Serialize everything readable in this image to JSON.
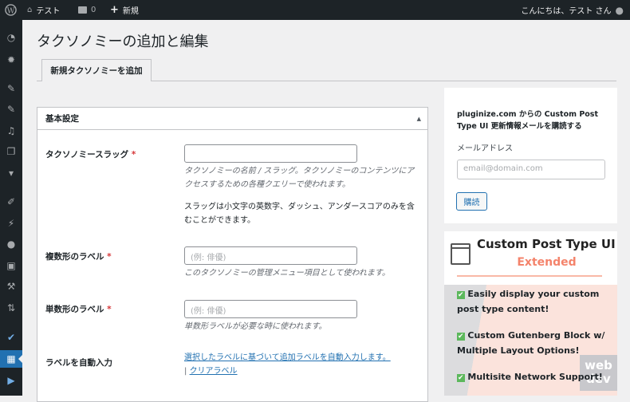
{
  "adminbar": {
    "site": "テスト",
    "comments": "0",
    "new": "新規",
    "greeting": "こんにちは、テスト さん"
  },
  "page": {
    "title": "タクソノミーの追加と編集",
    "tab": "新規タクソノミーを追加"
  },
  "box": {
    "title": "基本設定",
    "slug_label": "タクソノミースラッグ",
    "required": "*",
    "slug_desc": "タクソノミーの名前 / スラッグ。タクソノミーのコンテンツにアクセスするための各種クエリーで使われます。",
    "slug_note": "スラッグは小文字の英数字、ダッシュ、アンダースコアのみを含むことができます。",
    "plural_label": "複数形のラベル",
    "plural_placeholder": "(例: 俳優)",
    "plural_desc": "このタクソノミーの管理メニュー項目として使われます。",
    "singular_label": "単数形のラベル",
    "singular_placeholder": "(例: 俳優)",
    "singular_desc": "単数形ラベルが必要な時に使われます。",
    "auto_label": "ラベルを自動入力",
    "auto_link": "選択したラベルに基づいて追加ラベルを自動入力します。",
    "sep": "|",
    "clear_link": "クリアラベル"
  },
  "widget": {
    "heading": "pluginize.com からの Custom Post Type UI 更新情報メールを購読する",
    "email_label": "メールアドレス",
    "email_placeholder": "email@domain.com",
    "subscribe": "購読"
  },
  "banner": {
    "title": "Custom Post Type UI",
    "subtitle": "Extended",
    "features": [
      "Easily display your custom post type content!",
      "Custom Gutenberg Block w/ Multiple Layout Options!",
      "Multisite Network Support!"
    ],
    "watermark": "web dev",
    "accent": "#f4836b"
  }
}
